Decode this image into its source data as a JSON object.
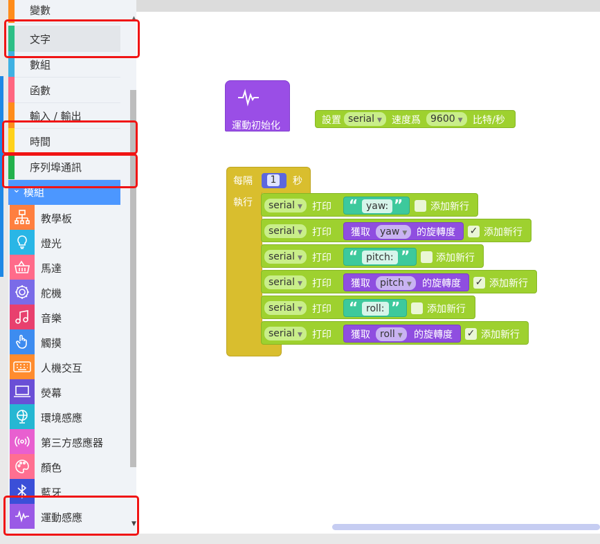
{
  "sidebar": {
    "categories": [
      {
        "label": "變數",
        "color": "#ff8c1a"
      },
      {
        "label": "文字",
        "color": "#2cbf86"
      },
      {
        "label": "數組",
        "color": "#3fb1e3"
      },
      {
        "label": "函數",
        "color": "#ff6680"
      },
      {
        "label": "輸入 / 輸出",
        "color": "#ff8c1a"
      },
      {
        "label": "時間",
        "color": "#ffd21a"
      },
      {
        "label": "序列埠通訊",
        "color": "#22b14c"
      }
    ],
    "modules_header": "模組",
    "modules": [
      {
        "label": "教學板",
        "icon": "circuit-board-icon",
        "color": "#ff7f3f"
      },
      {
        "label": "燈光",
        "icon": "lightbulb-icon",
        "color": "#29b6e6"
      },
      {
        "label": "馬達",
        "icon": "motor-basket-icon",
        "color": "#ff6b8a"
      },
      {
        "label": "舵機",
        "icon": "servo-gear-icon",
        "color": "#7a6be8"
      },
      {
        "label": "音樂",
        "icon": "music-note-icon",
        "color": "#e8406e"
      },
      {
        "label": "觸摸",
        "icon": "touch-hand-icon",
        "color": "#3d8cf0"
      },
      {
        "label": "人機交互",
        "icon": "keyboard-icon",
        "color": "#ff8c2e"
      },
      {
        "label": "熒幕",
        "icon": "laptop-screen-icon",
        "color": "#6a4fd6"
      },
      {
        "label": "環境感應",
        "icon": "globe-icon",
        "color": "#25b7d3"
      },
      {
        "label": "第三方感應器",
        "icon": "sensor-waves-icon",
        "color": "#e85fd0"
      },
      {
        "label": "顏色",
        "icon": "palette-icon",
        "color": "#ff6f91"
      },
      {
        "label": "藍牙",
        "icon": "bluetooth-icon",
        "color": "#3b4fd8"
      },
      {
        "label": "運動感應",
        "icon": "motion-wave-icon",
        "color": "#9a5ae6"
      }
    ]
  },
  "blocks": {
    "init_block": {
      "label": "運動初始化"
    },
    "serial_setup": {
      "set": "設置",
      "port": "serial",
      "speed": "速度爲",
      "baud": "9600",
      "unit": "比特/秒"
    },
    "every": {
      "label": "每隔",
      "value": "1",
      "unit": "秒",
      "do": "執行"
    },
    "rows": [
      {
        "port": "serial",
        "print": "打印",
        "kind": "text",
        "text": "yaw:",
        "newline_label": "添加新行",
        "newline": false
      },
      {
        "port": "serial",
        "print": "打印",
        "kind": "get",
        "get": "獲取",
        "axis": "yaw",
        "suffix": "的旋轉度",
        "newline_label": "添加新行",
        "newline": true
      },
      {
        "port": "serial",
        "print": "打印",
        "kind": "text",
        "text": "pitch:",
        "newline_label": "添加新行",
        "newline": false
      },
      {
        "port": "serial",
        "print": "打印",
        "kind": "get",
        "get": "獲取",
        "axis": "pitch",
        "suffix": "的旋轉度",
        "newline_label": "添加新行",
        "newline": true
      },
      {
        "port": "serial",
        "print": "打印",
        "kind": "text",
        "text": "roll:",
        "newline_label": "添加新行",
        "newline": false
      },
      {
        "port": "serial",
        "print": "打印",
        "kind": "get",
        "get": "獲取",
        "axis": "roll",
        "suffix": "的旋轉度",
        "newline_label": "添加新行",
        "newline": true
      }
    ],
    "check_mark": "✓",
    "open_quote": "“",
    "close_quote": "”"
  }
}
